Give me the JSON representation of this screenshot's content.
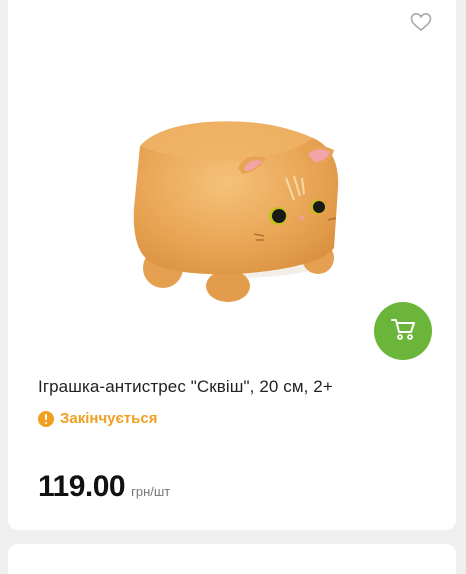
{
  "product": {
    "title": "Іграшка-антистрес \"Сквіш\", 20 см, 2+",
    "stock_status": "Закінчується",
    "price": "119.00",
    "price_unit": "грн/шт"
  },
  "icons": {
    "favorite": "heart-outline-icon",
    "cart": "shopping-cart-icon",
    "warning": "exclamation-circle-icon"
  },
  "colors": {
    "accent_green": "#6ab53a",
    "warning_orange": "#f0a020"
  }
}
